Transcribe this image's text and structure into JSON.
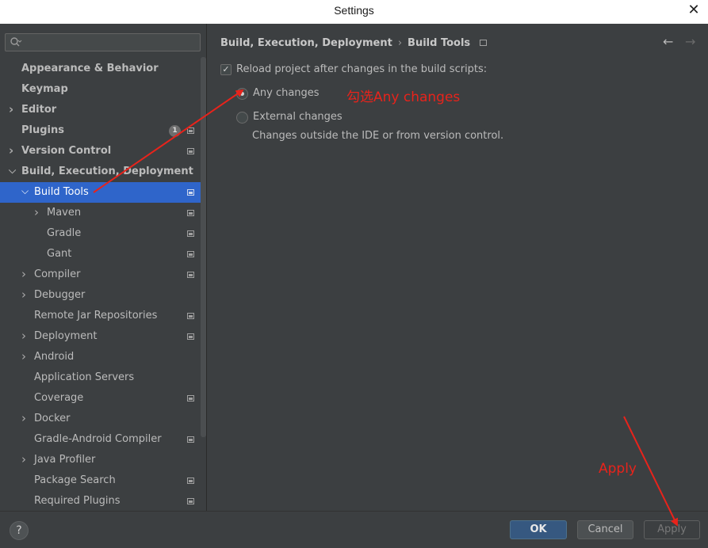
{
  "window": {
    "title": "Settings",
    "close_glyph": "✕"
  },
  "search": {
    "placeholder": "",
    "icon": "search-icon"
  },
  "sidebar": {
    "items": [
      {
        "label": "Appearance & Behavior",
        "level": 0,
        "bold": true,
        "expandable": false,
        "pin": false
      },
      {
        "label": "Keymap",
        "level": 0,
        "bold": true,
        "expandable": false,
        "pin": false
      },
      {
        "label": "Editor",
        "level": 0,
        "bold": true,
        "expandable": true,
        "expanded": false,
        "pin": false
      },
      {
        "label": "Plugins",
        "level": 0,
        "bold": true,
        "expandable": false,
        "pin": true,
        "badge": "1"
      },
      {
        "label": "Version Control",
        "level": 0,
        "bold": true,
        "expandable": true,
        "expanded": false,
        "pin": true
      },
      {
        "label": "Build, Execution, Deployment",
        "level": 0,
        "bold": true,
        "expandable": true,
        "expanded": true,
        "pin": false
      },
      {
        "label": "Build Tools",
        "level": 1,
        "bold": false,
        "expandable": true,
        "expanded": true,
        "pin": true,
        "selected": true
      },
      {
        "label": "Maven",
        "level": 2,
        "bold": false,
        "expandable": true,
        "expanded": false,
        "pin": true
      },
      {
        "label": "Gradle",
        "level": 2,
        "bold": false,
        "expandable": false,
        "pin": true
      },
      {
        "label": "Gant",
        "level": 2,
        "bold": false,
        "expandable": false,
        "pin": true
      },
      {
        "label": "Compiler",
        "level": 1,
        "bold": false,
        "expandable": true,
        "expanded": false,
        "pin": true
      },
      {
        "label": "Debugger",
        "level": 1,
        "bold": false,
        "expandable": true,
        "expanded": false,
        "pin": false
      },
      {
        "label": "Remote Jar Repositories",
        "level": 1,
        "bold": false,
        "expandable": false,
        "pin": true
      },
      {
        "label": "Deployment",
        "level": 1,
        "bold": false,
        "expandable": true,
        "expanded": false,
        "pin": true
      },
      {
        "label": "Android",
        "level": 1,
        "bold": false,
        "expandable": true,
        "expanded": false,
        "pin": false
      },
      {
        "label": "Application Servers",
        "level": 1,
        "bold": false,
        "expandable": false,
        "pin": false
      },
      {
        "label": "Coverage",
        "level": 1,
        "bold": false,
        "expandable": false,
        "pin": true
      },
      {
        "label": "Docker",
        "level": 1,
        "bold": false,
        "expandable": true,
        "expanded": false,
        "pin": false
      },
      {
        "label": "Gradle-Android Compiler",
        "level": 1,
        "bold": false,
        "expandable": false,
        "pin": true
      },
      {
        "label": "Java Profiler",
        "level": 1,
        "bold": false,
        "expandable": true,
        "expanded": false,
        "pin": false
      },
      {
        "label": "Package Search",
        "level": 1,
        "bold": false,
        "expandable": false,
        "pin": true
      },
      {
        "label": "Required Plugins",
        "level": 1,
        "bold": false,
        "expandable": false,
        "pin": true
      }
    ]
  },
  "main": {
    "breadcrumb": {
      "parent": "Build, Execution, Deployment",
      "separator": "›",
      "current": "Build Tools"
    },
    "nav": {
      "back": "←",
      "forward": "→"
    },
    "reload_checkbox": {
      "label": "Reload project after changes in the build scripts:",
      "checked": true,
      "check_glyph": "✓"
    },
    "radios": [
      {
        "label": "Any changes",
        "selected": true
      },
      {
        "label": "External changes",
        "selected": false
      }
    ],
    "hint": "Changes outside the IDE or from version control."
  },
  "annotations": {
    "any_changes_note": "勾选Any changes",
    "apply_note": "Apply",
    "color": "#e8231b"
  },
  "footer": {
    "help": "?",
    "ok": "OK",
    "cancel": "Cancel",
    "apply": "Apply"
  },
  "colors": {
    "background": "#3c3f41",
    "selection": "#2f65ca",
    "ok_button": "#365880",
    "titlebar": "#ffffff"
  }
}
